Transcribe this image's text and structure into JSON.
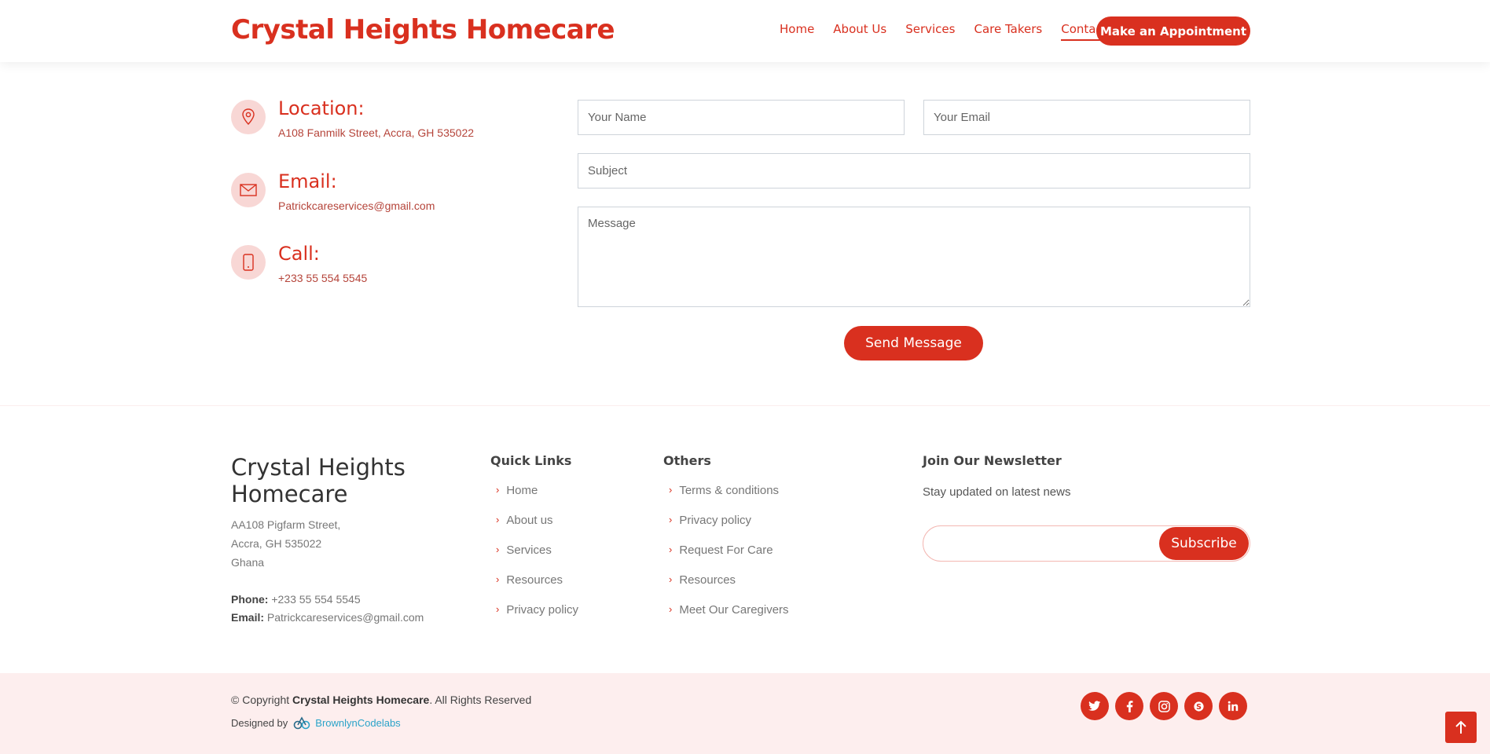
{
  "header": {
    "logo": "Crystal Heights Homecare",
    "nav": [
      "Home",
      "About Us",
      "Services",
      "Care Takers",
      "Contact"
    ],
    "active_nav": "Contact",
    "appointment_label": "Make an Appointment"
  },
  "contact_info": {
    "location_title": "Location:",
    "location_text": "A108 Fanmilk Street, Accra, GH 535022",
    "email_title": "Email:",
    "email_text": "Patrickcareservices@gmail.com",
    "call_title": "Call:",
    "call_text": "+233 55 554 5545"
  },
  "form": {
    "name_placeholder": "Your Name",
    "email_placeholder": "Your Email",
    "subject_placeholder": "Subject",
    "message_placeholder": "Message",
    "send_label": "Send Message"
  },
  "footer": {
    "brand_line1": "Crystal Heights",
    "brand_line2": "Homecare",
    "address_line1": "AA108 Pigfarm Street,",
    "address_line2": "Accra, GH 535022",
    "address_line3": "Ghana",
    "phone_label": "Phone:",
    "phone_value": "+233 55 554 5545",
    "email_label": "Email:",
    "email_value": "Patrickcareservices@gmail.com",
    "quick_links_title": "Quick Links",
    "quick_links": [
      "Home",
      "About us",
      "Services",
      "Resources",
      "Privacy policy"
    ],
    "others_title": "Others",
    "others": [
      "Terms & conditions",
      "Privacy policy",
      "Request For Care",
      "Resources",
      "Meet Our Caregivers"
    ],
    "newsletter_title": "Join Our Newsletter",
    "newsletter_subtitle": "Stay updated on latest news",
    "subscribe_label": "Subscribe"
  },
  "bottom": {
    "copyright_prefix": "© Copyright",
    "copyright_brand": "Crystal Heights Homecare",
    "copyright_suffix": ". All Rights Reserved",
    "designed_by": "Designed by",
    "designer": "BrownlynCodelabs",
    "social": [
      "twitter-icon",
      "facebook-icon",
      "instagram-icon",
      "skype-icon",
      "linkedin-icon"
    ]
  },
  "colors": {
    "accent": "#d9301f",
    "accent_light": "#f8d7d5",
    "bottom_bg": "#fdeeee"
  }
}
